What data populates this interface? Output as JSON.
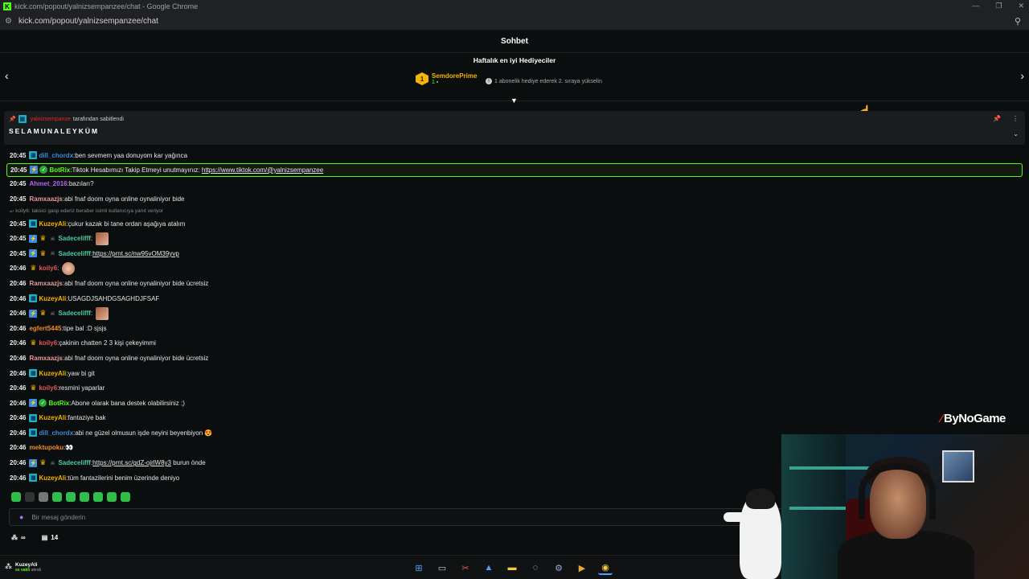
{
  "browser": {
    "window_title": "kick.com/popout/yalnizsempanzee/chat - Google Chrome",
    "url": "kick.com/popout/yalnizsempanzee/chat"
  },
  "chat": {
    "title": "Sohbet",
    "top_gifters": {
      "title": "Haftalık en iyi Hediyeciler",
      "rank": "1",
      "name": "SemdorePrime",
      "count": "1",
      "hint": "1 abonelik hediye ederek 2. sıraya yükselin"
    },
    "pinned": {
      "user": "yalnizsempanze",
      "suffix": "tarafından sabitlendi",
      "message": "SELAMUNALEYKÜM"
    },
    "messages": [
      {
        "time": "20:45",
        "user": "dill_chordx",
        "color": "#3a8ad8",
        "text": "ben sevmem yaa donuyom kar yağınca"
      },
      {
        "time": "20:45",
        "user": "BotRix",
        "color": "#53fc18",
        "text": "Tiktok Hesabımızı Takip Etmeyi unutmayınız:",
        "link": "https://www.tiktok.com/@yalnizsempanzee"
      },
      {
        "time": "20:45",
        "user": "Ahmet_2016",
        "color": "#b565f5",
        "text": "bazıları?"
      },
      {
        "time": "20:45",
        "user": "Ramxaazjs",
        "color": "#e89a9a",
        "text": "abi fnaf doom oyna online oynaliniyor bide"
      },
      {
        "reply": "koily6: taksici gasp ederiz beraber isimli kullanıcıya yanıt veriyor"
      },
      {
        "time": "20:45",
        "user": "KuzeyAli",
        "color": "#f5b400",
        "text": "çukur kazak bi tane ordan aşağıya atalım"
      },
      {
        "time": "20:45",
        "user": "Sadecelifff",
        "color": "#4ec9a0",
        "text": ""
      },
      {
        "time": "20:45",
        "user": "Sadecelifff",
        "color": "#4ec9a0",
        "text": "",
        "link": "https://prnt.sc/nw95vOM39yvp"
      },
      {
        "time": "20:46",
        "user": "koily6",
        "color": "#e05a5a",
        "text": ""
      },
      {
        "time": "20:46",
        "user": "Ramxaazjs",
        "color": "#e89a9a",
        "text": "abi fnaf doom oyna online oynaliniyor bide ücretsiz"
      },
      {
        "time": "20:46",
        "user": "KuzeyAli",
        "color": "#f5b400",
        "text": "USAGDJSAHDGSAGHDJFSAF"
      },
      {
        "time": "20:46",
        "user": "Sadecelifff",
        "color": "#4ec9a0",
        "text": ""
      },
      {
        "time": "20:46",
        "user": "egfert5445",
        "color": "#f08a2a",
        "text": "tipe bal :D sjsjs"
      },
      {
        "time": "20:46",
        "user": "koily6",
        "color": "#e05a5a",
        "text": "çakinin chatten 2 3 kişi çekeyimmi"
      },
      {
        "time": "20:46",
        "user": "Ramxaazjs",
        "color": "#e89a9a",
        "text": "abi fnaf doom oyna online oynaliniyor bide ücretsiz"
      },
      {
        "time": "20:46",
        "user": "KuzeyAli",
        "color": "#f5b400",
        "text": "yaw bi git"
      },
      {
        "time": "20:46",
        "user": "koily6",
        "color": "#e05a5a",
        "text": "resmini yaparlar"
      },
      {
        "time": "20:46",
        "user": "BotRix",
        "color": "#53fc18",
        "text": "Abone olarak bana destek olabilirsiniz ;)"
      },
      {
        "time": "20:46",
        "user": "KuzeyAli",
        "color": "#f5b400",
        "text": "fantaziye bak"
      },
      {
        "time": "20:46",
        "user": "dill_chordx",
        "color": "#3a8ad8",
        "text": "abi ne güzel olmusun işde neyini beyenbiyon 😍"
      },
      {
        "time": "20:46",
        "user": "mektupoku",
        "color": "#f08a2a",
        "text": "👀"
      },
      {
        "time": "20:46",
        "user": "Sadecelifff",
        "color": "#4ec9a0",
        "text": "burun önde",
        "link": "https://prnt.sc/gdZ-ojrlW8y3"
      },
      {
        "time": "20:46",
        "user": "KuzeyAli",
        "color": "#f5b400",
        "text": "tüm fantazilerini benim üzerinde deniyo"
      }
    ],
    "input_placeholder": "Bir mesaj gönderin",
    "viewers": "∞",
    "gift_count": "14"
  },
  "taskbar": {
    "user": "KuzeyAli",
    "status_prefix": "sıı vakti",
    "status_suffix": "atındı"
  },
  "watermark": "ByNoGame",
  "colors": {
    "accent": "#53fc18",
    "background": "#0b0e0f"
  }
}
